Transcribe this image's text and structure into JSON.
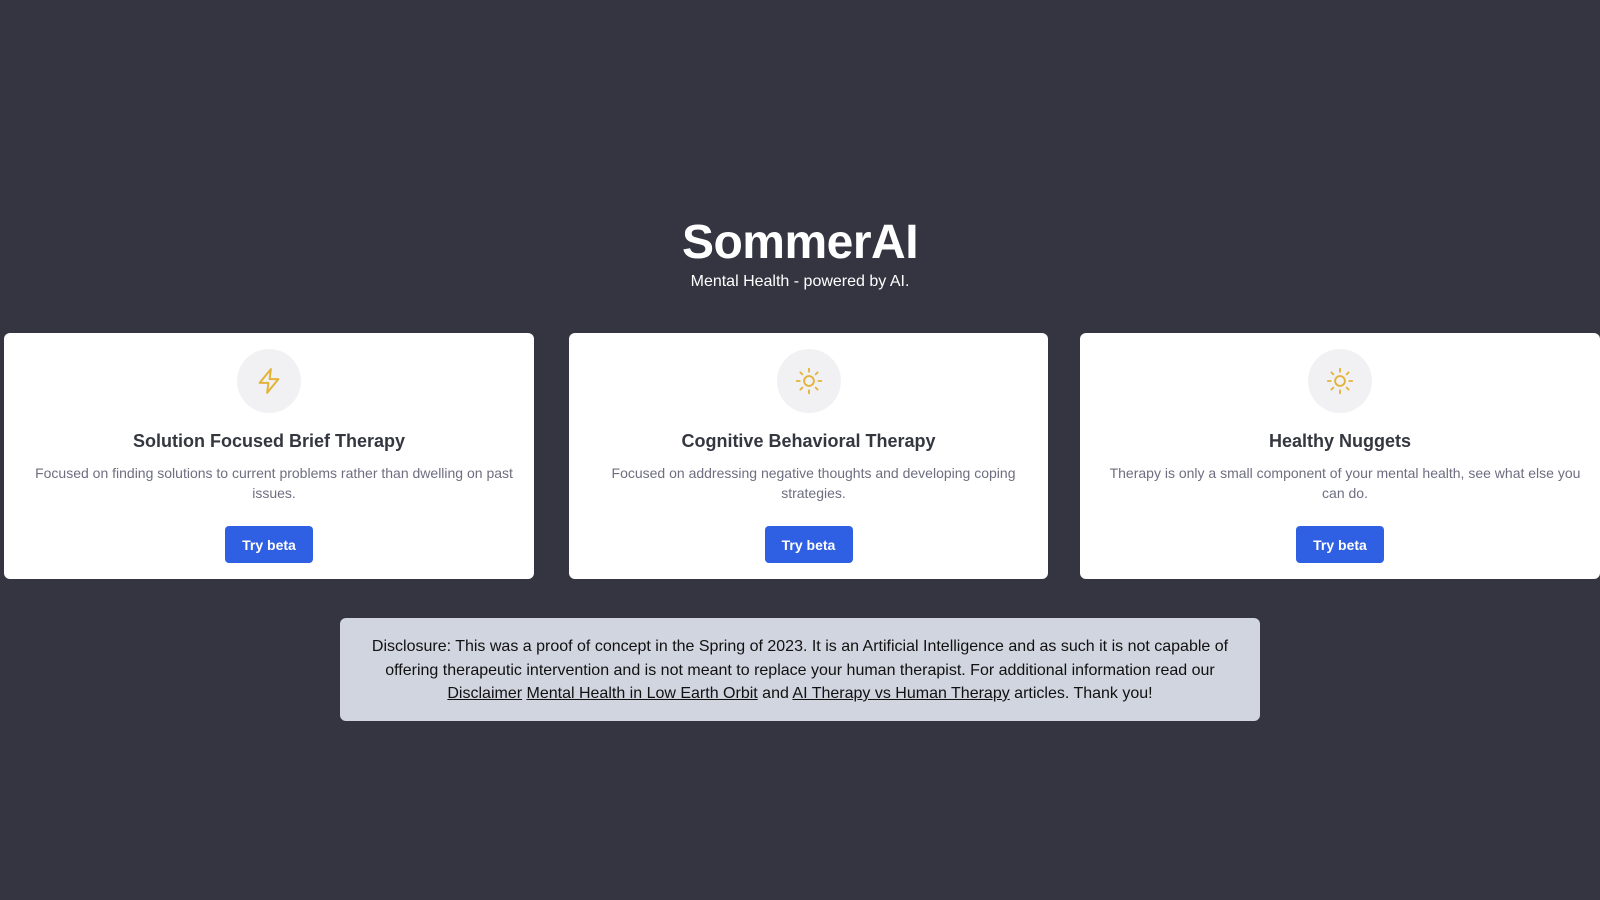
{
  "header": {
    "title": "SommerAI",
    "subtitle": "Mental Health - powered by AI."
  },
  "cards": [
    {
      "icon": "lightning-bolt-icon",
      "title": "Solution Focused Brief Therapy",
      "description": "Focused on finding solutions to current problems rather than dwelling on past issues.",
      "button_label": "Try beta"
    },
    {
      "icon": "sun-icon",
      "title": "Cognitive Behavioral Therapy",
      "description": "Focused on addressing negative thoughts and developing coping strategies.",
      "button_label": "Try beta"
    },
    {
      "icon": "sun-icon",
      "title": "Healthy Nuggets",
      "description": "Therapy is only a small component of your mental health, see what else you can do.",
      "button_label": "Try beta"
    }
  ],
  "disclosure": {
    "text_before": "Disclosure: This was a proof of concept in the Spring of 2023. It is an Artificial Intelligence and as such it is not capable of offering therapeutic intervention and is not meant to replace your human therapist. For additional information read our ",
    "link_disclaimer": "Disclaimer",
    "link_leo": "Mental Health in Low Earth Orbit",
    "text_and": " and ",
    "link_ai_vs_human": "AI Therapy vs Human Therapy",
    "text_after": " articles. Thank you!"
  },
  "colors": {
    "background": "#343541",
    "card": "#ffffff",
    "button": "#2f5fe2",
    "icon": "#e3b33a",
    "disclosure_bg": "#d0d5df"
  }
}
